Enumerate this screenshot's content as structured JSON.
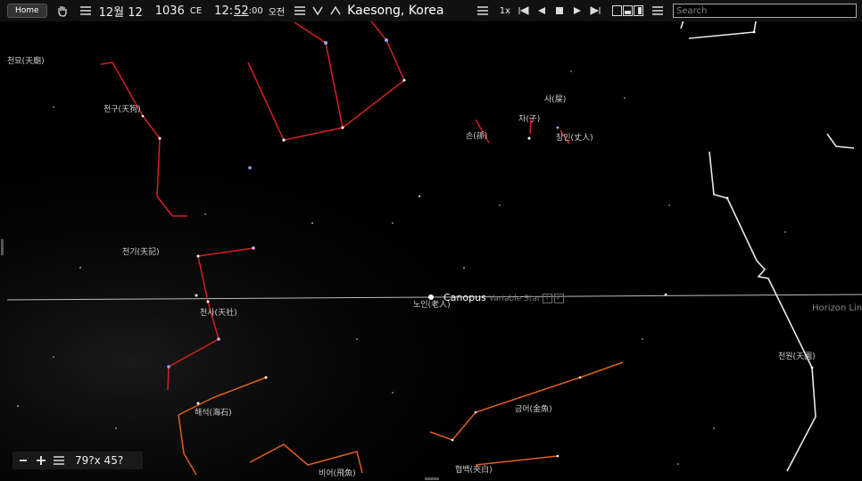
{
  "toolbar": {
    "home_label": "Home",
    "icons": [
      "hand-icon",
      "menu-icon",
      "menu-icon-2",
      "chevron-down-icon",
      "chevron-up-icon"
    ],
    "month_day": "12월 12",
    "year": "1036",
    "era": "CE",
    "hour": "12:",
    "minute": "52",
    "seconds": ":00",
    "ampm": "오전",
    "location": "Kaesong, Korea",
    "speed": "1x",
    "search_placeholder": "Search"
  },
  "labels": {
    "cheonmyo": "천묘(天廟)",
    "cheongu": "천구(天狗)",
    "cheongi": "천기(天記)",
    "cheonsa": "천사(天社)",
    "haeseok": "해석(海石)",
    "sa": "사(屎)",
    "ja": "자(子)",
    "son": "손(孫)",
    "jangin": "장인(丈人)",
    "noin": "노인(老人)",
    "geumeo": "금어(金魚)",
    "cheonwon": "천원(天園)",
    "hyeolbaek": "협백(夾白)",
    "bieo": "비어(飛魚)"
  },
  "canopus": {
    "name": "Canopus",
    "type": "Variable Star"
  },
  "horizon_label": "Horizon Line",
  "bottom": {
    "fov": "79?x 45?"
  },
  "colors": {
    "constellation": "#d42020",
    "constellation_alt": "#e0601a",
    "lines": "#e8e8e8"
  }
}
